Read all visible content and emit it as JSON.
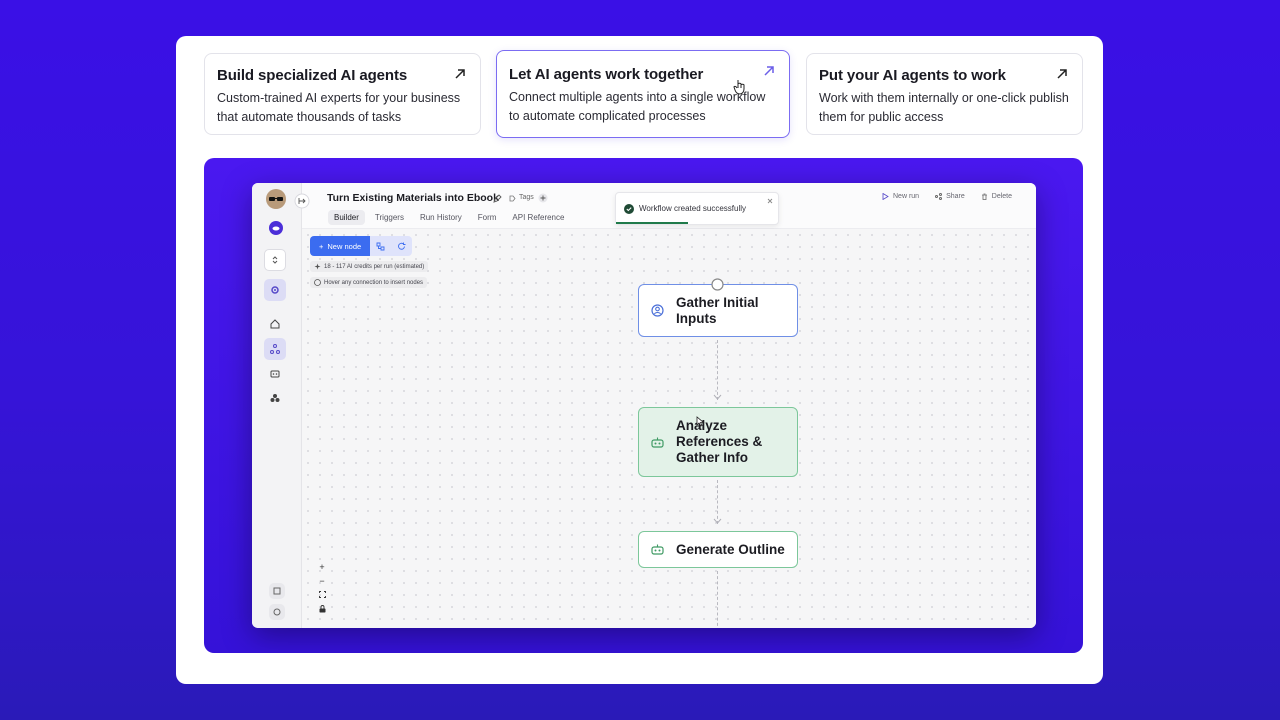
{
  "features": [
    {
      "title": "Build specialized AI agents",
      "desc": "Custom-trained AI experts for your business that automate thousands of tasks"
    },
    {
      "title": "Let AI agents work together",
      "desc": "Connect multiple agents into a single workflow to automate complicated processes"
    },
    {
      "title": "Put your AI agents to work",
      "desc": "Work with them internally or one-click publish them for public access"
    }
  ],
  "app": {
    "workflow_title": "Turn Existing Materials into Ebook",
    "tags_label": "Tags",
    "tabs": [
      "Builder",
      "Triggers",
      "Run History",
      "Form",
      "API Reference"
    ],
    "actions": {
      "new_run": "New run",
      "share": "Share",
      "delete": "Delete"
    },
    "toast": "Workflow created successfully",
    "toolbar": {
      "new_node": "New node"
    },
    "credits": "18 - 117 AI credits per run (estimated)",
    "hint": "Hover any connection to insert nodes",
    "nodes": [
      "Gather Initial Inputs",
      "Analyze References & Gather Info",
      "Generate Outline"
    ],
    "zoom": {
      "in": "+",
      "out": "−"
    }
  },
  "colors": {
    "accent": "#3b6cf0",
    "active_border": "#7b6cf2",
    "success": "#1f7a4a"
  }
}
